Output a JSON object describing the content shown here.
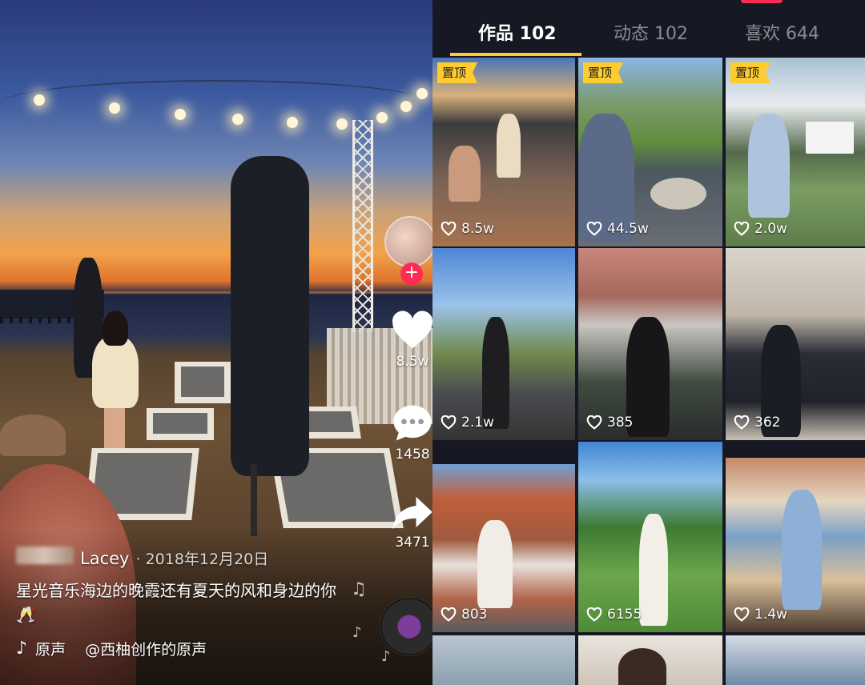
{
  "video": {
    "author": {
      "name": "Lacey",
      "date": "· 2018年12月20日"
    },
    "description": "星光音乐海边的晚霞还有夏天的风和身边的你 🥂",
    "music": {
      "original_label": "原声",
      "track": "@西柚创作的原声"
    },
    "actions": {
      "likes": "8.5w",
      "comments": "1458",
      "shares": "3471"
    },
    "follow_symbol": "+"
  },
  "profile": {
    "tabs": [
      {
        "label": "作品 102",
        "active": true
      },
      {
        "label": "动态 102",
        "active": false
      },
      {
        "label": "喜欢 644",
        "active": false
      }
    ],
    "pin_label": "置顶",
    "tiles": [
      {
        "likes": "8.5w",
        "pinned": true
      },
      {
        "likes": "44.5w",
        "pinned": true
      },
      {
        "likes": "2.0w",
        "pinned": true
      },
      {
        "likes": "2.1w",
        "pinned": false
      },
      {
        "likes": "385",
        "pinned": false
      },
      {
        "likes": "362",
        "pinned": false
      },
      {
        "likes": "803",
        "pinned": false
      },
      {
        "likes": "6155",
        "pinned": false
      },
      {
        "likes": "1.4w",
        "pinned": false
      }
    ]
  },
  "colors": {
    "accent_yellow": "#fecc2e",
    "accent_red": "#fe2c55",
    "profile_bg": "#161823",
    "tab_inactive": "#8a8b91"
  },
  "icons": [
    "heart-icon",
    "comment-icon",
    "share-icon",
    "music-note-icon",
    "tiktok-note-icon",
    "plus-icon"
  ]
}
